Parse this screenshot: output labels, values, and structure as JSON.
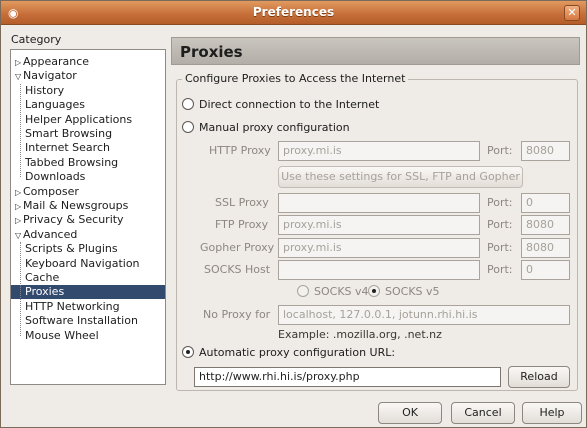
{
  "window": {
    "title": "Preferences",
    "app_icon": "app-icon",
    "close_icon": "close-icon"
  },
  "category": {
    "label": "Category",
    "items": [
      {
        "label": "Appearance",
        "level": 0,
        "expander": "collapsed"
      },
      {
        "label": "Navigator",
        "level": 0,
        "expander": "expanded"
      },
      {
        "label": "History",
        "level": 1
      },
      {
        "label": "Languages",
        "level": 1
      },
      {
        "label": "Helper Applications",
        "level": 1
      },
      {
        "label": "Smart Browsing",
        "level": 1
      },
      {
        "label": "Internet Search",
        "level": 1
      },
      {
        "label": "Tabbed Browsing",
        "level": 1
      },
      {
        "label": "Downloads",
        "level": 1
      },
      {
        "label": "Composer",
        "level": 0,
        "expander": "collapsed"
      },
      {
        "label": "Mail & Newsgroups",
        "level": 0,
        "expander": "collapsed"
      },
      {
        "label": "Privacy & Security",
        "level": 0,
        "expander": "collapsed"
      },
      {
        "label": "Advanced",
        "level": 0,
        "expander": "expanded"
      },
      {
        "label": "Scripts & Plugins",
        "level": 1
      },
      {
        "label": "Keyboard Navigation",
        "level": 1
      },
      {
        "label": "Cache",
        "level": 1
      },
      {
        "label": "Proxies",
        "level": 1,
        "selected": true
      },
      {
        "label": "HTTP Networking",
        "level": 1
      },
      {
        "label": "Software Installation",
        "level": 1
      },
      {
        "label": "Mouse Wheel",
        "level": 1
      }
    ]
  },
  "panel": {
    "title": "Proxies",
    "group_label": "Configure Proxies to Access the Internet",
    "direct": "Direct connection to the Internet",
    "manual": "Manual proxy configuration",
    "http_label": "HTTP Proxy",
    "http_value": "proxy.mi.is",
    "http_port_label": "Port:",
    "http_port": "8080",
    "same_settings_button": "Use these settings for SSL, FTP and Gopher",
    "ssl_label": "SSL Proxy",
    "ssl_value": "",
    "ssl_port_label": "Port:",
    "ssl_port": "0",
    "ftp_label": "FTP Proxy",
    "ftp_value": "proxy.mi.is",
    "ftp_port_label": "Port:",
    "ftp_port": "8080",
    "gopher_label": "Gopher Proxy",
    "gopher_value": "proxy.mi.is",
    "gopher_port_label": "Port:",
    "gopher_port": "8080",
    "socks_label": "SOCKS Host",
    "socks_value": "",
    "socks_port_label": "Port:",
    "socks_port": "0",
    "socks_v4": "SOCKS v4",
    "socks_v5": "SOCKS v5",
    "no_proxy_label": "No Proxy for",
    "no_proxy_value": "localhost, 127.0.0.1, jotunn.rhi.hi.is",
    "example": "Example: .mozilla.org, .net.nz",
    "auto": "Automatic proxy configuration URL:",
    "auto_url": "http://www.rhi.hi.is/proxy.php",
    "reload_button": "Reload"
  },
  "footer": {
    "ok": "OK",
    "cancel": "Cancel",
    "help": "Help"
  },
  "colors": {
    "titlebar": "#c8703b",
    "selection": "#324a6e",
    "panel_header": "#b9b4ad"
  }
}
